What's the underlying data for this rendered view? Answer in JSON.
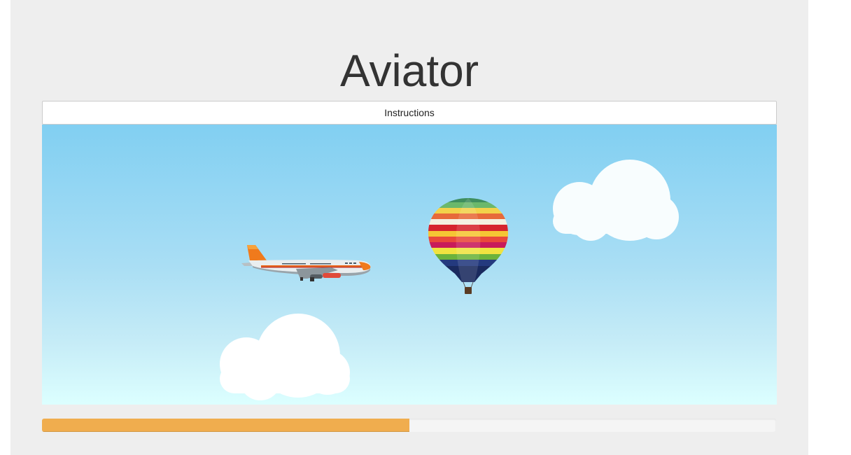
{
  "app": {
    "title": "Aviator"
  },
  "instructions": {
    "label": "Instructions"
  },
  "game": {
    "sprites": [
      {
        "name": "airplane",
        "icon": "airplane-icon"
      },
      {
        "name": "hot-air-balloon",
        "icon": "hot-air-balloon-icon"
      },
      {
        "name": "cloud",
        "icon": "cloud-icon"
      },
      {
        "name": "cloud",
        "icon": "cloud-icon"
      }
    ],
    "sky_colors": {
      "top": "#81cff2",
      "bottom": "#dcffff"
    }
  },
  "progress": {
    "percent": 50,
    "color": "#f0ad4e",
    "track_color": "#f5f5f5"
  }
}
